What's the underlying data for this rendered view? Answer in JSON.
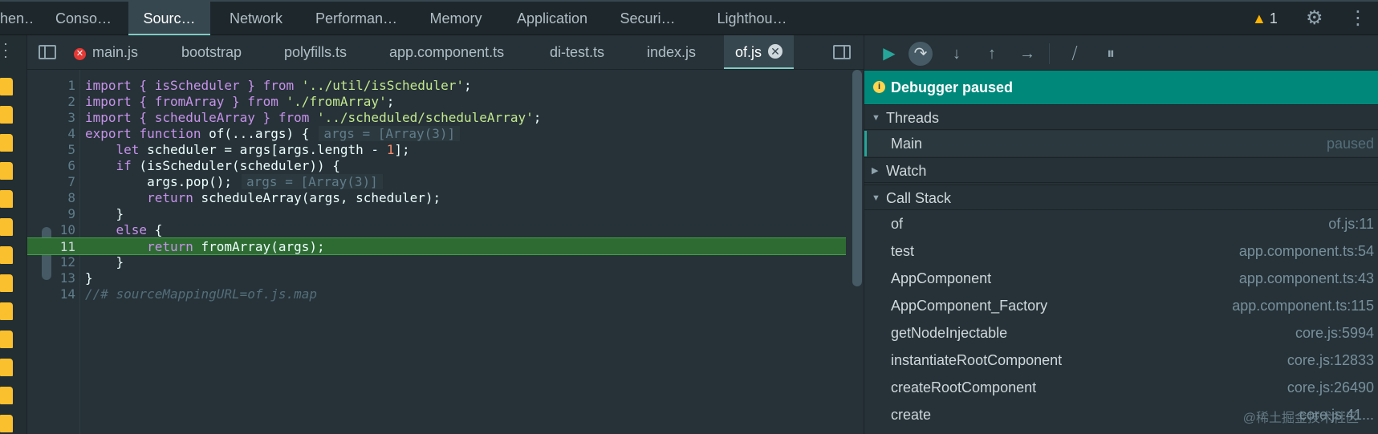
{
  "top_tabs": [
    {
      "label": "hen…"
    },
    {
      "label": "Conso…"
    },
    {
      "label": "Sourc…"
    },
    {
      "label": "Network"
    },
    {
      "label": "Performan…"
    },
    {
      "label": "Memory"
    },
    {
      "label": "Application"
    },
    {
      "label": "Securi…"
    },
    {
      "label": "Lighthou…"
    }
  ],
  "warnings": {
    "count": "1"
  },
  "icons": {
    "settings": "gear-icon",
    "more": "kebab-icon",
    "warning": "warning-triangle-icon"
  },
  "editor_tabs": [
    {
      "label": "main.js"
    },
    {
      "label": "bootstrap"
    },
    {
      "label": "polyfills.ts"
    },
    {
      "label": "app.component.ts"
    },
    {
      "label": "di-test.ts"
    },
    {
      "label": "index.js"
    },
    {
      "label": "of.js"
    }
  ],
  "code": {
    "current_line": "11",
    "lines": [
      {
        "n": "1"
      },
      {
        "n": "2"
      },
      {
        "n": "3"
      },
      {
        "n": "4"
      },
      {
        "n": "5"
      },
      {
        "n": "6"
      },
      {
        "n": "7"
      },
      {
        "n": "8"
      },
      {
        "n": "9"
      },
      {
        "n": "10"
      },
      {
        "n": "11"
      },
      {
        "n": "12"
      },
      {
        "n": "13"
      },
      {
        "n": "14"
      }
    ],
    "text": {
      "l1_pre": "import { isScheduler } ",
      "l1_from": "from",
      "l1_str": "'../util/isScheduler'",
      "l2_pre": "import { fromArray } ",
      "l2_from": "from",
      "l2_str": "'./fromArray'",
      "l3_pre": "import { scheduleArray } ",
      "l3_from": "from",
      "l3_str": "'../scheduled/scheduleArray'",
      "l4_export": "export",
      "l4_function": "function",
      "l4_rest": " of(...args) {",
      "l4_inline": "args = [Array(3)]",
      "l5_let": "let",
      "l5_rest": " scheduler = args[args.length - ",
      "l5_num": "1",
      "l5_end": "];",
      "l6_if": "if",
      "l6_rest": " (isScheduler(scheduler)) {",
      "l7_code": "args.pop();",
      "l7_inline": "args = [Array(3)]",
      "l8_return": "return",
      "l8_rest": " scheduleArray(args, scheduler);",
      "l9": "}",
      "l10_else": "else",
      "l10_rest": " {",
      "l11_return": "return",
      "l11_rest": " fromArray(args);",
      "l12": "}",
      "l13": "}",
      "l14": "//# sourceMappingURL=of.js.map"
    }
  },
  "debugger": {
    "banner": "Debugger paused",
    "threads": {
      "title": "Threads",
      "items": [
        {
          "name": "Main",
          "status": "paused"
        }
      ]
    },
    "watch": {
      "title": "Watch"
    },
    "call_stack": {
      "title": "Call Stack",
      "frames": [
        {
          "fn": "of",
          "loc": "of.js:11"
        },
        {
          "fn": "test",
          "loc": "app.component.ts:54"
        },
        {
          "fn": "AppComponent",
          "loc": "app.component.ts:43"
        },
        {
          "fn": "AppComponent_Factory",
          "loc": "app.component.ts:115"
        },
        {
          "fn": "getNodeInjectable",
          "loc": "core.js:5994"
        },
        {
          "fn": "instantiateRootComponent",
          "loc": "core.js:12833"
        },
        {
          "fn": "createRootComponent",
          "loc": "core.js:26490"
        },
        {
          "fn": "create",
          "loc": "core.js:41..."
        }
      ]
    }
  },
  "watermark": "@稀土掘金技术社区",
  "colors": {
    "accent": "#00897b",
    "current_line": "#2e6b32",
    "keyword": "#c792ea",
    "string": "#c3e88d",
    "number": "#f78c6c",
    "file_icon": "#fbc02d"
  }
}
